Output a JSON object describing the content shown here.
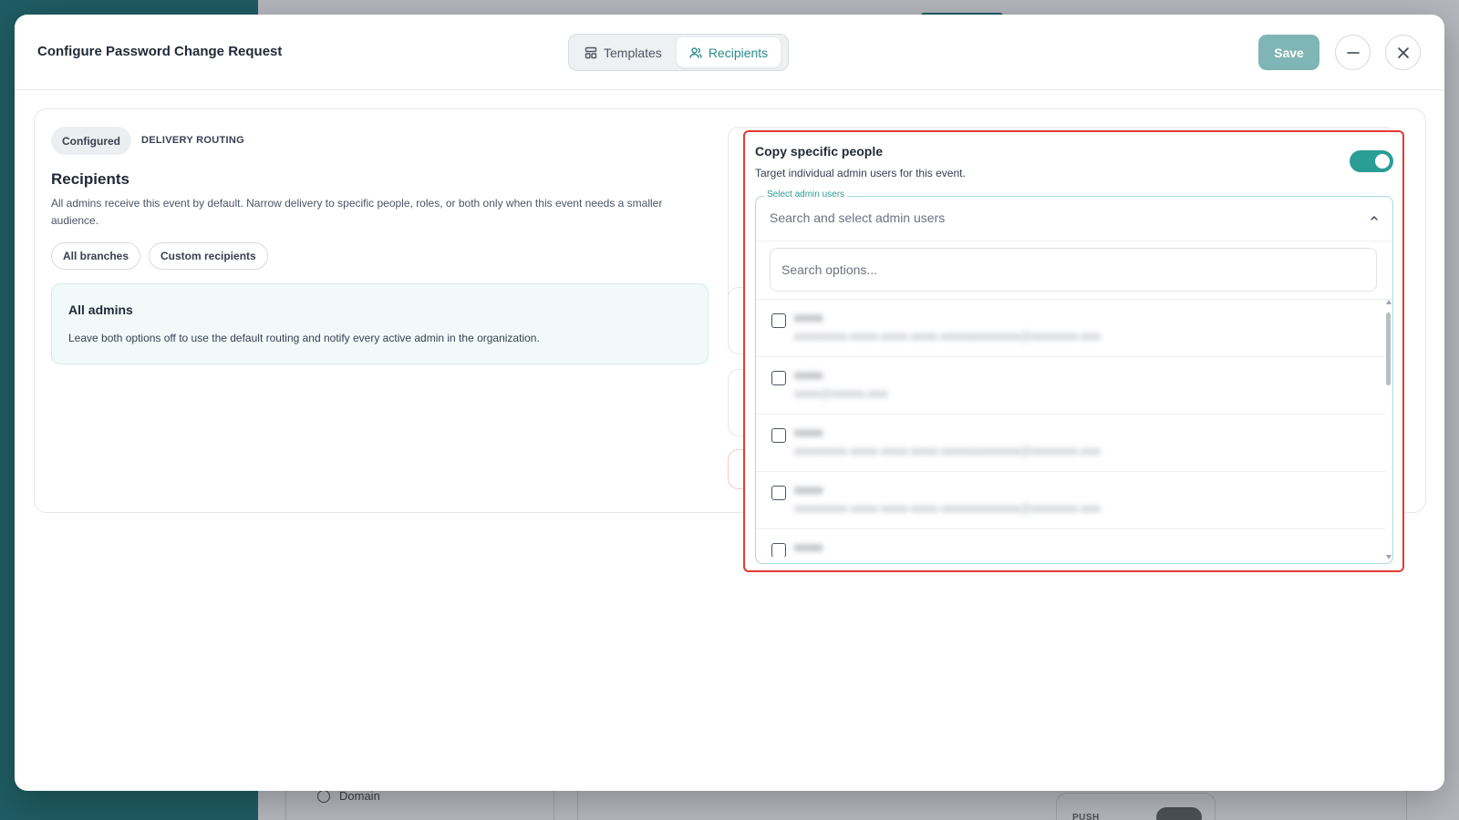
{
  "background": {
    "nav_item_label": "Domain",
    "push_label": "PUSH"
  },
  "header": {
    "title": "Configure Password Change Request",
    "tabs": [
      {
        "label": "Templates",
        "icon": "template-icon",
        "active": false
      },
      {
        "label": "Recipients",
        "icon": "users-icon",
        "active": true
      }
    ],
    "save_label": "Save"
  },
  "routing": {
    "status_pill": "Configured",
    "section_label": "DELIVERY ROUTING",
    "title": "Recipients",
    "description": "All admins receive this event by default. Narrow delivery to specific people, roles, or both only when this event needs a smaller audience.",
    "chips": [
      "All branches",
      "Custom recipients"
    ],
    "default_box": {
      "title": "All admins",
      "description": "Leave both options off to use the default routing and notify every active admin in the organization."
    }
  },
  "copy_people": {
    "title": "Copy specific people",
    "description": "Target individual admin users for this event.",
    "enabled": true,
    "select": {
      "label": "Select admin users",
      "placeholder": "Search and select admin users",
      "search_placeholder": "Search options...",
      "options": [
        {
          "name": "●●●●",
          "email": "●●●●●●●●-●●●●-●●●●-●●●●-●●●●●●●●●●●●@●●●●●●●.●●●"
        },
        {
          "name": "●●●●",
          "email": "●●●●@●●●●●.●●●"
        },
        {
          "name": "●●●●",
          "email": "●●●●●●●●-●●●●-●●●●-●●●●-●●●●●●●●●●●●@●●●●●●●.●●●"
        },
        {
          "name": "●●●●",
          "email": "●●●●●●●●-●●●●-●●●●-●●●●-●●●●●●●●●●●●@●●●●●●●.●●●"
        },
        {
          "name": "●●●●",
          "email": "●●●●@●●●●●.●●●"
        }
      ]
    }
  },
  "colors": {
    "accent": "#2a9d94",
    "highlight_border": "#e53935",
    "save_button": "#7fb5b4",
    "sidebar_bg": "#1f5c63"
  }
}
